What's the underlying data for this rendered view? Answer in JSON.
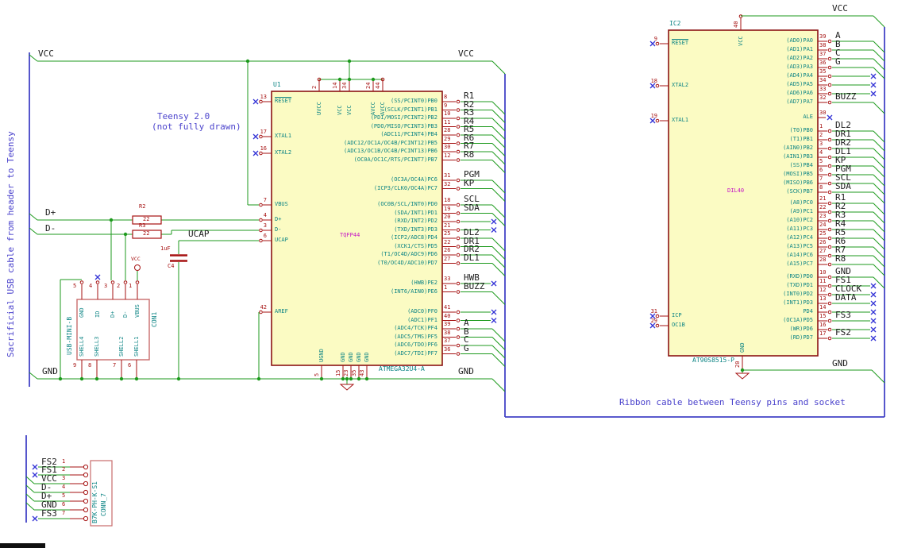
{
  "colors": {
    "wire": "#1d9a1d",
    "bus": "#4343c6",
    "pin": "#a61212",
    "xmark": "#3434d6",
    "body_fill": "#fbfbc3",
    "body_stroke": "#8b1313",
    "conn_stroke": "#c96c6c"
  },
  "notes": {
    "teensy_line1": "Teensy 2.0",
    "teensy_line2": "(not fully drawn)",
    "usb_cable": "Sacrificial USB cable from header to Teensy",
    "ribbon_cable": "Ribbon cable between Teensy pins and socket"
  },
  "net_labels": {
    "vcc_left": "VCC",
    "vcc_right": "VCC",
    "vcc_ic2": "VCC",
    "gnd_left": "GND",
    "gnd_right": "GND",
    "gnd_ic2": "GND",
    "d_plus": "D+",
    "d_minus": "D-",
    "ucap": "UCAP"
  },
  "u1": {
    "ref": "U1",
    "value": "ATMEGA32U4-A",
    "footprint": "TQFP44",
    "top_pins": [
      {
        "num": "2",
        "name": "UVCC"
      },
      {
        "num": "14",
        "name": "VCC"
      },
      {
        "num": "34",
        "name": "VCC"
      },
      {
        "num": "24",
        "name": "AVCC"
      },
      {
        "num": "44",
        "name": "AVCC"
      }
    ],
    "bottom_pins": [
      {
        "num": "5",
        "name": "UGND"
      },
      {
        "num": "15",
        "name": "GND"
      },
      {
        "num": "23",
        "name": "GND"
      },
      {
        "num": "35",
        "name": "GND"
      },
      {
        "num": "43",
        "name": "GND"
      }
    ],
    "left_pins": [
      {
        "num": "13",
        "name": "RESET",
        "bar": true,
        "conn": "nc"
      },
      {
        "num": "17",
        "name": "XTAL1",
        "conn": "nc"
      },
      {
        "num": "16",
        "name": "XTAL2",
        "conn": "nc"
      },
      {
        "num": "7",
        "name": "VBUS",
        "conn": "wire"
      },
      {
        "num": "4",
        "name": "D+",
        "conn": "wire"
      },
      {
        "num": "3",
        "name": "D-",
        "conn": "wire"
      },
      {
        "num": "6",
        "name": "UCAP",
        "conn": "wire"
      },
      {
        "num": "42",
        "name": "AREF",
        "conn": "wire"
      }
    ],
    "right_groups": [
      {
        "pins": [
          {
            "num": "8",
            "name": "(SS/PCINT0)PB0",
            "label": "R1",
            "conn": "bus"
          },
          {
            "num": "9",
            "name": "(SCLK/PCINT1)PB1",
            "label": "R2",
            "conn": "bus"
          },
          {
            "num": "10",
            "name": "(PDI/MOSI/PCINT2)PB2",
            "label": "R3",
            "conn": "bus"
          },
          {
            "num": "11",
            "name": "(PDO/MISO/PCINT3)PB3",
            "label": "R4",
            "conn": "bus"
          },
          {
            "num": "28",
            "name": "(ADC11/PCINT4)PB4",
            "label": "R5",
            "conn": "bus"
          },
          {
            "num": "29",
            "name": "(ADC12/OC1A/OC4B/PCINT12)PB5",
            "label": "R6",
            "conn": "bus"
          },
          {
            "num": "30",
            "name": "(ADC13/OC1B/OC4B/PCINT13)PB6",
            "label": "R7",
            "conn": "bus"
          },
          {
            "num": "12",
            "name": "(OC0A/OC1C/RTS/PCINT7)PB7",
            "label": "R8",
            "conn": "bus"
          }
        ]
      },
      {
        "pins": [
          {
            "num": "31",
            "name": "(OC3A/OC4A)PC6",
            "label": "PGM",
            "conn": "bus"
          },
          {
            "num": "32",
            "name": "(ICP3/CLK0/OC4A)PC7",
            "label": "KP",
            "conn": "bus"
          }
        ]
      },
      {
        "pins": [
          {
            "num": "18",
            "name": "(OC0B/SCL/INT0)PD0",
            "label": "SCL",
            "conn": "bus"
          },
          {
            "num": "19",
            "name": "(SDA/INT1)PD1",
            "label": "SDA",
            "conn": "bus"
          },
          {
            "num": "20",
            "name": "(RXD/INT2)PD2",
            "conn": "nc"
          },
          {
            "num": "21",
            "name": "(TXD/INT3)PD3",
            "conn": "nc"
          },
          {
            "num": "25",
            "name": "(ICP2/ADC8)PD4",
            "label": "DL2",
            "conn": "bus"
          },
          {
            "num": "22",
            "name": "(XCK1/CTS)PD5",
            "label": "DR1",
            "conn": "bus"
          },
          {
            "num": "26",
            "name": "(T1/OC4D/ADC9)PD6",
            "label": "DR2",
            "conn": "bus"
          },
          {
            "num": "27",
            "name": "(T0/OC4D/ADC10)PD7",
            "label": "DL1",
            "conn": "bus"
          }
        ]
      },
      {
        "pins": [
          {
            "num": "33",
            "name": "(HWB)PE2",
            "label": "HWB",
            "conn": "nc"
          },
          {
            "num": "1",
            "name": "(INT6/AIN0)PE6",
            "label": "BUZZ",
            "conn": "bus"
          }
        ]
      },
      {
        "pins": [
          {
            "num": "41",
            "name": "(ADC0)PF0",
            "conn": "nc"
          },
          {
            "num": "40",
            "name": "(ADC1)PF1",
            "conn": "nc"
          },
          {
            "num": "39",
            "name": "(ADC4/TCK)PF4",
            "label": "A",
            "conn": "bus"
          },
          {
            "num": "38",
            "name": "(ADC5/TMS)PF5",
            "label": "B",
            "conn": "bus"
          },
          {
            "num": "37",
            "name": "(ADC6/TDO)PF6",
            "label": "C",
            "conn": "bus"
          },
          {
            "num": "36",
            "name": "(ADC7/TDI)PF7",
            "label": "G",
            "conn": "bus"
          }
        ]
      }
    ]
  },
  "ic2": {
    "ref": "IC2",
    "value": "AT90S8515-P",
    "footprint": "DIL40",
    "top_pin": {
      "num": "40",
      "name": "VCC"
    },
    "bottom_pin": {
      "num": "20",
      "name": "GND"
    },
    "left_pins": [
      {
        "num": "9",
        "name": "RESET",
        "bar": true
      },
      {
        "num": "18",
        "name": "XTAL2"
      },
      {
        "num": "19",
        "name": "XTAL1"
      },
      {
        "num": "31",
        "name": "ICP"
      },
      {
        "num": "29",
        "name": "OC1B"
      }
    ],
    "right_groups": [
      {
        "pins": [
          {
            "num": "39",
            "name": "(AD0)PA0",
            "label": "A",
            "conn": "bus"
          },
          {
            "num": "38",
            "name": "(AD1)PA1",
            "label": "B",
            "conn": "bus"
          },
          {
            "num": "37",
            "name": "(AD2)PA2",
            "label": "C",
            "conn": "bus"
          },
          {
            "num": "36",
            "name": "(AD3)PA3",
            "label": "G",
            "conn": "bus"
          },
          {
            "num": "35",
            "name": "(AD4)PA4",
            "conn": "nc"
          },
          {
            "num": "34",
            "name": "(AD5)PA5",
            "conn": "nc"
          },
          {
            "num": "33",
            "name": "(AD6)PA6",
            "conn": "nc"
          },
          {
            "num": "32",
            "name": "(AD7)PA7",
            "label": "BUZZ",
            "conn": "bus"
          }
        ]
      },
      {
        "pins": [
          {
            "num": "30",
            "name": "ALE",
            "conn": "stub"
          }
        ]
      },
      {
        "pins": [
          {
            "num": "1",
            "name": "(T0)PB0",
            "label": "DL2",
            "conn": "bus"
          },
          {
            "num": "2",
            "name": "(T1)PB1",
            "label": "DR1",
            "conn": "bus"
          },
          {
            "num": "3",
            "name": "(AIN0)PB2",
            "label": "DR2",
            "conn": "bus"
          },
          {
            "num": "4",
            "name": "(AIN1)PB3",
            "label": "DL1",
            "conn": "bus"
          },
          {
            "num": "5",
            "name": "(SS)PB4",
            "label": "KP",
            "conn": "bus"
          },
          {
            "num": "6",
            "name": "(MOSI)PB5",
            "label": "PGM",
            "conn": "bus"
          },
          {
            "num": "7",
            "name": "(MISO)PB6",
            "label": "SCL",
            "conn": "bus"
          },
          {
            "num": "8",
            "name": "(SCK)PB7",
            "label": "SDA",
            "conn": "bus"
          }
        ]
      },
      {
        "pins": [
          {
            "num": "21",
            "name": "(A8)PC0",
            "label": "R1",
            "conn": "bus"
          },
          {
            "num": "22",
            "name": "(A9)PC1",
            "label": "R2",
            "conn": "bus"
          },
          {
            "num": "23",
            "name": "(A10)PC2",
            "label": "R3",
            "conn": "bus"
          },
          {
            "num": "24",
            "name": "(A11)PC3",
            "label": "R4",
            "conn": "bus"
          },
          {
            "num": "25",
            "name": "(A12)PC4",
            "label": "R5",
            "conn": "bus"
          },
          {
            "num": "26",
            "name": "(A13)PC5",
            "label": "R6",
            "conn": "bus"
          },
          {
            "num": "27",
            "name": "(A14)PC6",
            "label": "R7",
            "conn": "bus"
          },
          {
            "num": "28",
            "name": "(A15)PC7",
            "label": "R8",
            "conn": "bus"
          }
        ]
      },
      {
        "pins": [
          {
            "num": "10",
            "name": "(RXD)PD0",
            "label": "GND",
            "conn": "bus"
          },
          {
            "num": "11",
            "name": "(TXD)PD1",
            "label": "FS1",
            "conn": "nc"
          },
          {
            "num": "12",
            "name": "(INT0)PD2",
            "label": "CLOCK",
            "conn": "nc"
          },
          {
            "num": "13",
            "name": "(INT1)PD3",
            "label": "DATA",
            "conn": "nc"
          },
          {
            "num": "14",
            "name": "PD4",
            "conn": "nc"
          },
          {
            "num": "15",
            "name": "(OC1A)PD5",
            "label": "FS3",
            "conn": "nc"
          },
          {
            "num": "16",
            "name": "(WR)PD6",
            "conn": "nc"
          },
          {
            "num": "17",
            "name": "(RD)PD7",
            "label": "FS2",
            "conn": "nc"
          }
        ]
      }
    ]
  },
  "con1": {
    "ref": "CON1",
    "value": "USB-MINI-B",
    "top_pins": [
      {
        "num": "5",
        "name": "GND"
      },
      {
        "num": "4",
        "name": "ID",
        "nc": true
      },
      {
        "num": "3",
        "name": "D+"
      },
      {
        "num": "2",
        "name": "D-"
      },
      {
        "num": "1",
        "name": "VBUS"
      }
    ],
    "bottom_pins": [
      {
        "num": "9",
        "name": "SHELL4"
      },
      {
        "num": "8",
        "name": "SHELL3"
      },
      {
        "num": "7",
        "name": "SHELL2"
      },
      {
        "num": "6",
        "name": "SHELL1"
      }
    ]
  },
  "conn7": {
    "ref": "CONN_7",
    "value": "B7K-PH-K-S1",
    "pins": [
      {
        "num": "1",
        "label": "FS2",
        "conn": "nc"
      },
      {
        "num": "2",
        "label": "FS1",
        "conn": "nc"
      },
      {
        "num": "3",
        "label": "VCC",
        "conn": "bus"
      },
      {
        "num": "4",
        "label": "D-",
        "conn": "bus"
      },
      {
        "num": "5",
        "label": "D+",
        "conn": "bus"
      },
      {
        "num": "6",
        "label": "GND",
        "conn": "bus"
      },
      {
        "num": "7",
        "label": "FS3",
        "conn": "nc"
      }
    ]
  },
  "r2": {
    "ref": "R2",
    "value": "22"
  },
  "r3": {
    "ref": "R3",
    "value": "22"
  },
  "c4": {
    "ref": "C4",
    "value": "1uF"
  },
  "vcc_symbol_label": "VCC"
}
